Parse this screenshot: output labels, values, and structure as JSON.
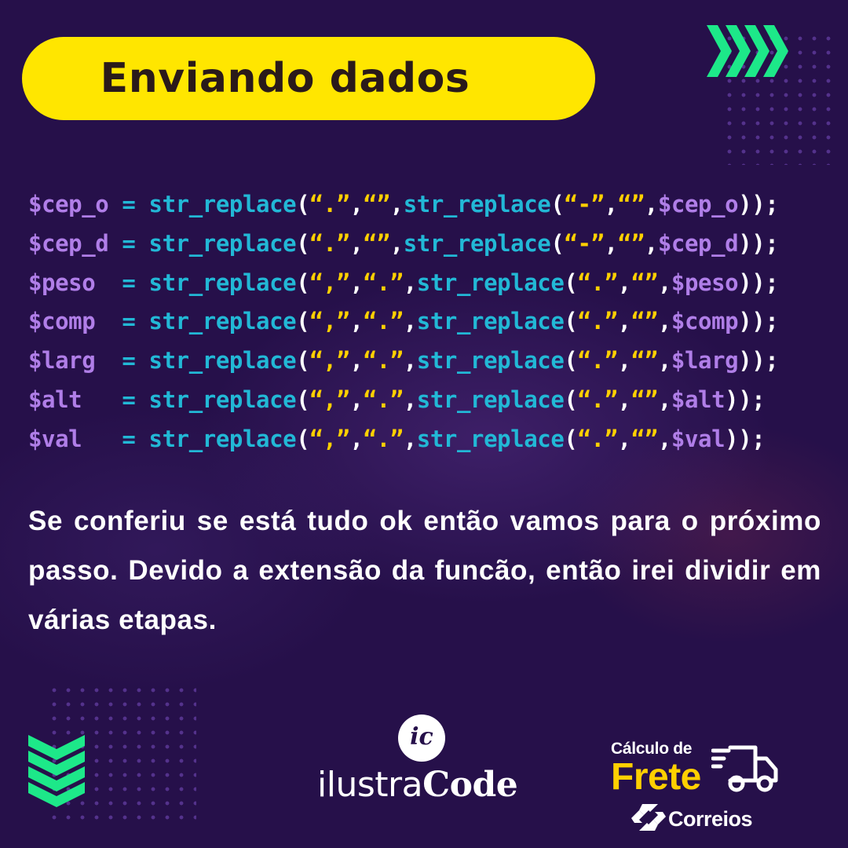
{
  "title": "Enviando dados",
  "code_lines": [
    [
      {
        "t": "$cep_o",
        "c": "v"
      },
      {
        "t": " = ",
        "c": "f"
      },
      {
        "t": "str_replace",
        "c": "f"
      },
      {
        "t": "(",
        "c": "p"
      },
      {
        "t": "“.”",
        "c": "s"
      },
      {
        "t": ",",
        "c": "p"
      },
      {
        "t": "“”",
        "c": "s"
      },
      {
        "t": ",",
        "c": "p"
      },
      {
        "t": "str_replace",
        "c": "f"
      },
      {
        "t": "(",
        "c": "p"
      },
      {
        "t": "“-”",
        "c": "s"
      },
      {
        "t": ",",
        "c": "p"
      },
      {
        "t": "“”",
        "c": "s"
      },
      {
        "t": ",",
        "c": "p"
      },
      {
        "t": "$cep_o",
        "c": "v"
      },
      {
        "t": "));",
        "c": "p"
      }
    ],
    [
      {
        "t": "$cep_d",
        "c": "v"
      },
      {
        "t": " = ",
        "c": "f"
      },
      {
        "t": "str_replace",
        "c": "f"
      },
      {
        "t": "(",
        "c": "p"
      },
      {
        "t": "“.”",
        "c": "s"
      },
      {
        "t": ",",
        "c": "p"
      },
      {
        "t": "“”",
        "c": "s"
      },
      {
        "t": ",",
        "c": "p"
      },
      {
        "t": "str_replace",
        "c": "f"
      },
      {
        "t": "(",
        "c": "p"
      },
      {
        "t": "“-”",
        "c": "s"
      },
      {
        "t": ",",
        "c": "p"
      },
      {
        "t": "“”",
        "c": "s"
      },
      {
        "t": ",",
        "c": "p"
      },
      {
        "t": "$cep_d",
        "c": "v"
      },
      {
        "t": "));",
        "c": "p"
      }
    ],
    [
      {
        "t": "$peso ",
        "c": "v"
      },
      {
        "t": " = ",
        "c": "f"
      },
      {
        "t": "str_replace",
        "c": "f"
      },
      {
        "t": "(",
        "c": "p"
      },
      {
        "t": "“,”",
        "c": "s"
      },
      {
        "t": ",",
        "c": "p"
      },
      {
        "t": "“.”",
        "c": "s"
      },
      {
        "t": ",",
        "c": "p"
      },
      {
        "t": "str_replace",
        "c": "f"
      },
      {
        "t": "(",
        "c": "p"
      },
      {
        "t": "“.”",
        "c": "s"
      },
      {
        "t": ",",
        "c": "p"
      },
      {
        "t": "“”",
        "c": "s"
      },
      {
        "t": ",",
        "c": "p"
      },
      {
        "t": "$peso",
        "c": "v"
      },
      {
        "t": "));",
        "c": "p"
      }
    ],
    [
      {
        "t": "$comp ",
        "c": "v"
      },
      {
        "t": " = ",
        "c": "f"
      },
      {
        "t": "str_replace",
        "c": "f"
      },
      {
        "t": "(",
        "c": "p"
      },
      {
        "t": "“,”",
        "c": "s"
      },
      {
        "t": ",",
        "c": "p"
      },
      {
        "t": "“.”",
        "c": "s"
      },
      {
        "t": ",",
        "c": "p"
      },
      {
        "t": "str_replace",
        "c": "f"
      },
      {
        "t": "(",
        "c": "p"
      },
      {
        "t": "“.”",
        "c": "s"
      },
      {
        "t": ",",
        "c": "p"
      },
      {
        "t": "“”",
        "c": "s"
      },
      {
        "t": ",",
        "c": "p"
      },
      {
        "t": "$comp",
        "c": "v"
      },
      {
        "t": "));",
        "c": "p"
      }
    ],
    [
      {
        "t": "$larg ",
        "c": "v"
      },
      {
        "t": " = ",
        "c": "f"
      },
      {
        "t": "str_replace",
        "c": "f"
      },
      {
        "t": "(",
        "c": "p"
      },
      {
        "t": "“,”",
        "c": "s"
      },
      {
        "t": ",",
        "c": "p"
      },
      {
        "t": "“.”",
        "c": "s"
      },
      {
        "t": ",",
        "c": "p"
      },
      {
        "t": "str_replace",
        "c": "f"
      },
      {
        "t": "(",
        "c": "p"
      },
      {
        "t": "“.”",
        "c": "s"
      },
      {
        "t": ",",
        "c": "p"
      },
      {
        "t": "“”",
        "c": "s"
      },
      {
        "t": ",",
        "c": "p"
      },
      {
        "t": "$larg",
        "c": "v"
      },
      {
        "t": "));",
        "c": "p"
      }
    ],
    [
      {
        "t": "$alt  ",
        "c": "v"
      },
      {
        "t": " = ",
        "c": "f"
      },
      {
        "t": "str_replace",
        "c": "f"
      },
      {
        "t": "(",
        "c": "p"
      },
      {
        "t": "“,”",
        "c": "s"
      },
      {
        "t": ",",
        "c": "p"
      },
      {
        "t": "“.”",
        "c": "s"
      },
      {
        "t": ",",
        "c": "p"
      },
      {
        "t": "str_replace",
        "c": "f"
      },
      {
        "t": "(",
        "c": "p"
      },
      {
        "t": "“.”",
        "c": "s"
      },
      {
        "t": ",",
        "c": "p"
      },
      {
        "t": "“”",
        "c": "s"
      },
      {
        "t": ",",
        "c": "p"
      },
      {
        "t": "$alt",
        "c": "v"
      },
      {
        "t": "));",
        "c": "p"
      }
    ],
    [
      {
        "t": "$val  ",
        "c": "v"
      },
      {
        "t": " = ",
        "c": "f"
      },
      {
        "t": "str_replace",
        "c": "f"
      },
      {
        "t": "(",
        "c": "p"
      },
      {
        "t": "“,”",
        "c": "s"
      },
      {
        "t": ",",
        "c": "p"
      },
      {
        "t": "“.”",
        "c": "s"
      },
      {
        "t": ",",
        "c": "p"
      },
      {
        "t": "str_replace",
        "c": "f"
      },
      {
        "t": "(",
        "c": "p"
      },
      {
        "t": "“.”",
        "c": "s"
      },
      {
        "t": ",",
        "c": "p"
      },
      {
        "t": "“”",
        "c": "s"
      },
      {
        "t": ",",
        "c": "p"
      },
      {
        "t": "$val",
        "c": "v"
      },
      {
        "t": "));",
        "c": "p"
      }
    ]
  ],
  "paragraph": "Se conferiu se está tudo ok então vamos para o próximo passo. Devido a extensão da funcão, então irei dividir em várias etapas.",
  "logo": {
    "monogram": "ic",
    "name_light": "ilustra",
    "name_bold": "Code"
  },
  "frete_badge": {
    "line1": "Cálculo de",
    "line2": "Frete",
    "brand": "Correios"
  },
  "colors": {
    "background": "#26104a",
    "title_pill": "#ffe600",
    "variable": "#b07ee8",
    "function": "#22b8d6",
    "string": "#ffd000",
    "accent_green": "#1de889"
  },
  "icons": [
    "chevrons-right-icon",
    "chevrons-down-icon",
    "truck-icon",
    "correios-icon"
  ]
}
